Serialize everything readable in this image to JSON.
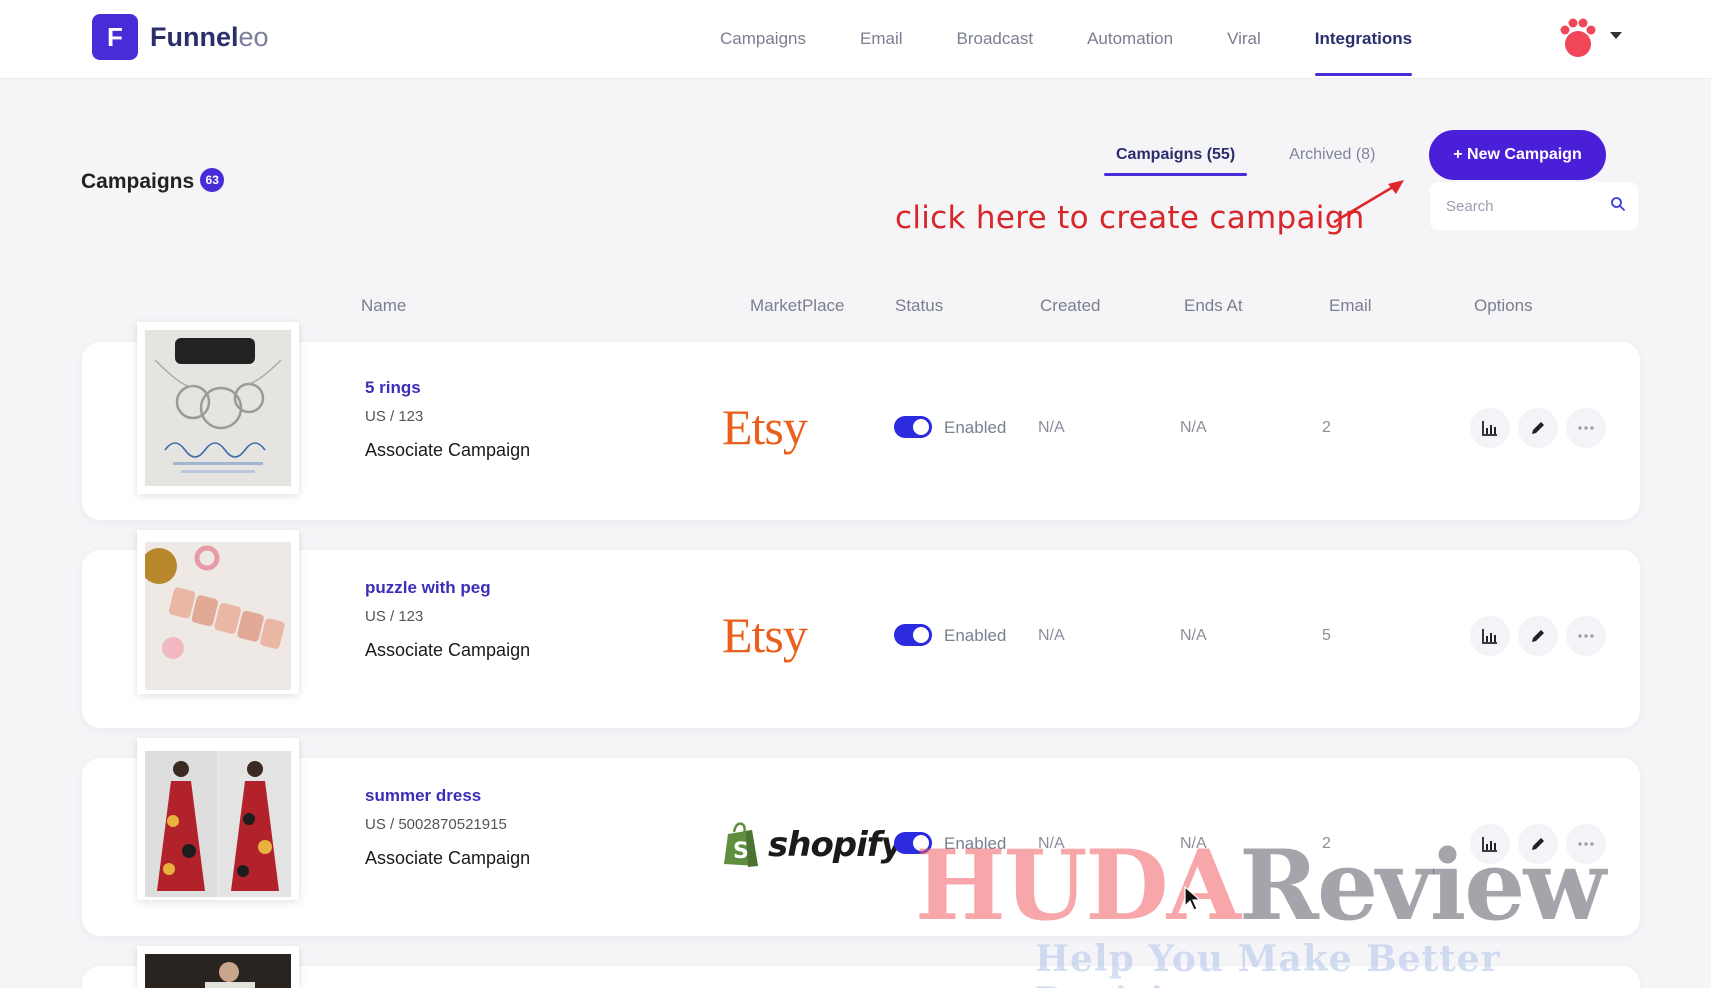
{
  "app": {
    "logo_letter": "F",
    "name_bold": "Funnel",
    "name_light": "eo"
  },
  "nav": {
    "items": [
      {
        "label": "Campaigns",
        "active": false
      },
      {
        "label": "Email",
        "active": false
      },
      {
        "label": "Broadcast",
        "active": false
      },
      {
        "label": "Automation",
        "active": false
      },
      {
        "label": "Viral",
        "active": false
      },
      {
        "label": "Integrations",
        "active": true
      }
    ],
    "avatar_icon": "paw-icon",
    "avatar_color": "#f04658"
  },
  "page": {
    "title": "Campaigns",
    "badge": "63"
  },
  "tabs": [
    {
      "label": "Campaigns (55)",
      "active": true
    },
    {
      "label": "Archived (8)",
      "active": false
    }
  ],
  "actions": {
    "new_campaign_label": "+ New Campaign",
    "search_placeholder": "Search"
  },
  "annotation": {
    "text": "click here to create campaign",
    "color": "#d8262a"
  },
  "table": {
    "headers": {
      "name": "Name",
      "marketplace": "MarketPlace",
      "status": "Status",
      "created": "Created",
      "ends_at": "Ends At",
      "email": "Email",
      "options": "Options"
    },
    "rows": [
      {
        "name": "5 rings",
        "sub": "US / 123",
        "type": "Associate Campaign",
        "marketplace": "Etsy",
        "status_label": "Enabled",
        "enabled": true,
        "created": "N/A",
        "ends_at": "N/A",
        "email": "2",
        "thumb": "necklace-photo"
      },
      {
        "name": "puzzle with peg",
        "sub": "US / 123",
        "type": "Associate Campaign",
        "marketplace": "Etsy",
        "status_label": "Enabled",
        "enabled": true,
        "created": "N/A",
        "ends_at": "N/A",
        "email": "5",
        "thumb": "name-puzzle-photo"
      },
      {
        "name": "summer dress",
        "sub": "US / 5002870521915",
        "type": "Associate Campaign",
        "marketplace": "shopify",
        "status_label": "Enabled",
        "enabled": true,
        "created": "N/A",
        "ends_at": "N/A",
        "email": "2",
        "thumb": "dress-photo"
      }
    ]
  },
  "watermark": {
    "brand_a": "HUDA",
    "brand_b": "Review",
    "tagline": "Help You Make Better Decisions"
  },
  "colors": {
    "accent": "#4a2bd8",
    "button": "#4a1fd8",
    "toggle": "#2c2be0",
    "etsy": "#e8601c",
    "shopify_green": "#5e8e3e"
  }
}
